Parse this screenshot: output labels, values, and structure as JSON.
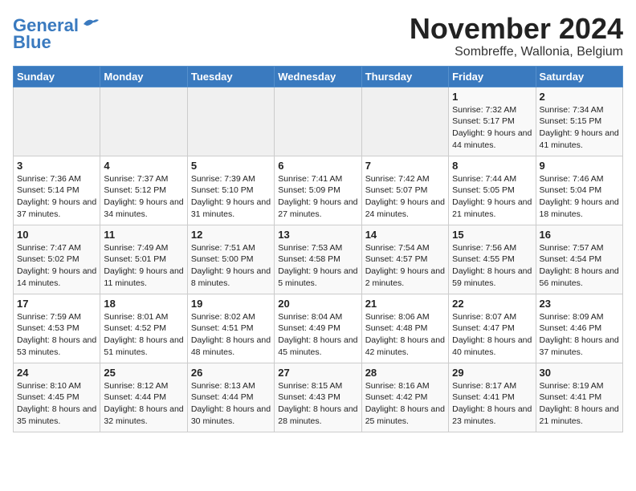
{
  "header": {
    "logo_line1": "General",
    "logo_line2": "Blue",
    "month": "November 2024",
    "location": "Sombreffe, Wallonia, Belgium"
  },
  "weekdays": [
    "Sunday",
    "Monday",
    "Tuesday",
    "Wednesday",
    "Thursday",
    "Friday",
    "Saturday"
  ],
  "weeks": [
    [
      {
        "day": "",
        "sunrise": "",
        "sunset": "",
        "daylight": ""
      },
      {
        "day": "",
        "sunrise": "",
        "sunset": "",
        "daylight": ""
      },
      {
        "day": "",
        "sunrise": "",
        "sunset": "",
        "daylight": ""
      },
      {
        "day": "",
        "sunrise": "",
        "sunset": "",
        "daylight": ""
      },
      {
        "day": "",
        "sunrise": "",
        "sunset": "",
        "daylight": ""
      },
      {
        "day": "1",
        "sunrise": "Sunrise: 7:32 AM",
        "sunset": "Sunset: 5:17 PM",
        "daylight": "Daylight: 9 hours and 44 minutes."
      },
      {
        "day": "2",
        "sunrise": "Sunrise: 7:34 AM",
        "sunset": "Sunset: 5:15 PM",
        "daylight": "Daylight: 9 hours and 41 minutes."
      }
    ],
    [
      {
        "day": "3",
        "sunrise": "Sunrise: 7:36 AM",
        "sunset": "Sunset: 5:14 PM",
        "daylight": "Daylight: 9 hours and 37 minutes."
      },
      {
        "day": "4",
        "sunrise": "Sunrise: 7:37 AM",
        "sunset": "Sunset: 5:12 PM",
        "daylight": "Daylight: 9 hours and 34 minutes."
      },
      {
        "day": "5",
        "sunrise": "Sunrise: 7:39 AM",
        "sunset": "Sunset: 5:10 PM",
        "daylight": "Daylight: 9 hours and 31 minutes."
      },
      {
        "day": "6",
        "sunrise": "Sunrise: 7:41 AM",
        "sunset": "Sunset: 5:09 PM",
        "daylight": "Daylight: 9 hours and 27 minutes."
      },
      {
        "day": "7",
        "sunrise": "Sunrise: 7:42 AM",
        "sunset": "Sunset: 5:07 PM",
        "daylight": "Daylight: 9 hours and 24 minutes."
      },
      {
        "day": "8",
        "sunrise": "Sunrise: 7:44 AM",
        "sunset": "Sunset: 5:05 PM",
        "daylight": "Daylight: 9 hours and 21 minutes."
      },
      {
        "day": "9",
        "sunrise": "Sunrise: 7:46 AM",
        "sunset": "Sunset: 5:04 PM",
        "daylight": "Daylight: 9 hours and 18 minutes."
      }
    ],
    [
      {
        "day": "10",
        "sunrise": "Sunrise: 7:47 AM",
        "sunset": "Sunset: 5:02 PM",
        "daylight": "Daylight: 9 hours and 14 minutes."
      },
      {
        "day": "11",
        "sunrise": "Sunrise: 7:49 AM",
        "sunset": "Sunset: 5:01 PM",
        "daylight": "Daylight: 9 hours and 11 minutes."
      },
      {
        "day": "12",
        "sunrise": "Sunrise: 7:51 AM",
        "sunset": "Sunset: 5:00 PM",
        "daylight": "Daylight: 9 hours and 8 minutes."
      },
      {
        "day": "13",
        "sunrise": "Sunrise: 7:53 AM",
        "sunset": "Sunset: 4:58 PM",
        "daylight": "Daylight: 9 hours and 5 minutes."
      },
      {
        "day": "14",
        "sunrise": "Sunrise: 7:54 AM",
        "sunset": "Sunset: 4:57 PM",
        "daylight": "Daylight: 9 hours and 2 minutes."
      },
      {
        "day": "15",
        "sunrise": "Sunrise: 7:56 AM",
        "sunset": "Sunset: 4:55 PM",
        "daylight": "Daylight: 8 hours and 59 minutes."
      },
      {
        "day": "16",
        "sunrise": "Sunrise: 7:57 AM",
        "sunset": "Sunset: 4:54 PM",
        "daylight": "Daylight: 8 hours and 56 minutes."
      }
    ],
    [
      {
        "day": "17",
        "sunrise": "Sunrise: 7:59 AM",
        "sunset": "Sunset: 4:53 PM",
        "daylight": "Daylight: 8 hours and 53 minutes."
      },
      {
        "day": "18",
        "sunrise": "Sunrise: 8:01 AM",
        "sunset": "Sunset: 4:52 PM",
        "daylight": "Daylight: 8 hours and 51 minutes."
      },
      {
        "day": "19",
        "sunrise": "Sunrise: 8:02 AM",
        "sunset": "Sunset: 4:51 PM",
        "daylight": "Daylight: 8 hours and 48 minutes."
      },
      {
        "day": "20",
        "sunrise": "Sunrise: 8:04 AM",
        "sunset": "Sunset: 4:49 PM",
        "daylight": "Daylight: 8 hours and 45 minutes."
      },
      {
        "day": "21",
        "sunrise": "Sunrise: 8:06 AM",
        "sunset": "Sunset: 4:48 PM",
        "daylight": "Daylight: 8 hours and 42 minutes."
      },
      {
        "day": "22",
        "sunrise": "Sunrise: 8:07 AM",
        "sunset": "Sunset: 4:47 PM",
        "daylight": "Daylight: 8 hours and 40 minutes."
      },
      {
        "day": "23",
        "sunrise": "Sunrise: 8:09 AM",
        "sunset": "Sunset: 4:46 PM",
        "daylight": "Daylight: 8 hours and 37 minutes."
      }
    ],
    [
      {
        "day": "24",
        "sunrise": "Sunrise: 8:10 AM",
        "sunset": "Sunset: 4:45 PM",
        "daylight": "Daylight: 8 hours and 35 minutes."
      },
      {
        "day": "25",
        "sunrise": "Sunrise: 8:12 AM",
        "sunset": "Sunset: 4:44 PM",
        "daylight": "Daylight: 8 hours and 32 minutes."
      },
      {
        "day": "26",
        "sunrise": "Sunrise: 8:13 AM",
        "sunset": "Sunset: 4:44 PM",
        "daylight": "Daylight: 8 hours and 30 minutes."
      },
      {
        "day": "27",
        "sunrise": "Sunrise: 8:15 AM",
        "sunset": "Sunset: 4:43 PM",
        "daylight": "Daylight: 8 hours and 28 minutes."
      },
      {
        "day": "28",
        "sunrise": "Sunrise: 8:16 AM",
        "sunset": "Sunset: 4:42 PM",
        "daylight": "Daylight: 8 hours and 25 minutes."
      },
      {
        "day": "29",
        "sunrise": "Sunrise: 8:17 AM",
        "sunset": "Sunset: 4:41 PM",
        "daylight": "Daylight: 8 hours and 23 minutes."
      },
      {
        "day": "30",
        "sunrise": "Sunrise: 8:19 AM",
        "sunset": "Sunset: 4:41 PM",
        "daylight": "Daylight: 8 hours and 21 minutes."
      }
    ]
  ]
}
